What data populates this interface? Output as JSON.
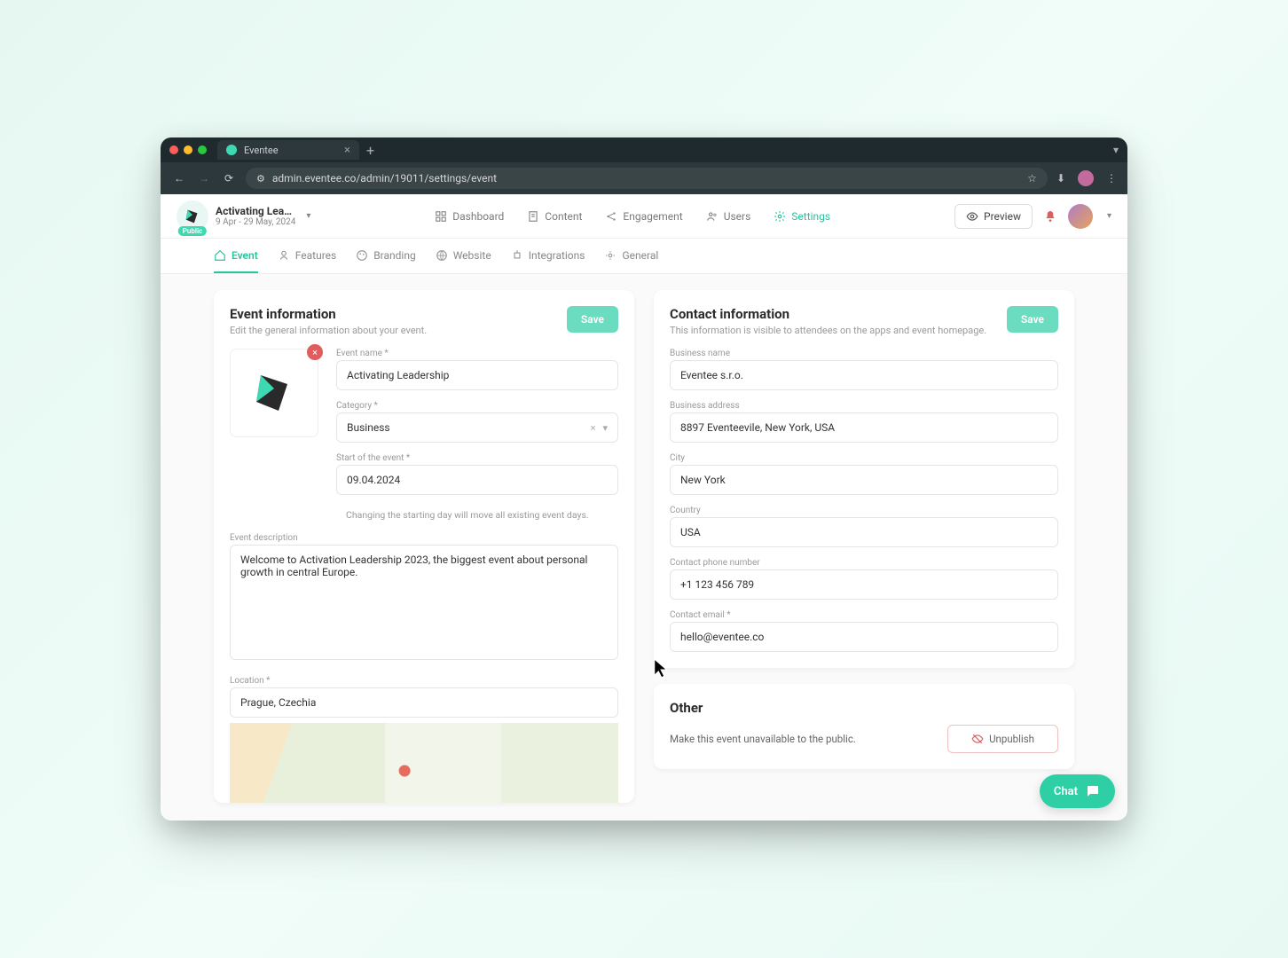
{
  "browser": {
    "tab_title": "Eventee",
    "url": "admin.eventee.co/admin/19011/settings/event"
  },
  "header": {
    "event_name_short": "Activating Lea…",
    "event_dates": "9 Apr - 29 May, 2024",
    "public_badge": "Public",
    "nav": {
      "dashboard": "Dashboard",
      "content": "Content",
      "engagement": "Engagement",
      "users": "Users",
      "settings": "Settings"
    },
    "preview": "Preview"
  },
  "subnav": {
    "event": "Event",
    "features": "Features",
    "branding": "Branding",
    "website": "Website",
    "integrations": "Integrations",
    "general": "General"
  },
  "event_info": {
    "title": "Event information",
    "subtitle": "Edit the general information about your event.",
    "save": "Save",
    "labels": {
      "name": "Event name *",
      "category": "Category *",
      "start": "Start of the event *",
      "description": "Event description",
      "location": "Location *"
    },
    "values": {
      "name": "Activating Leadership",
      "category": "Business",
      "start": "09.04.2024",
      "start_hint": "Changing the starting day will move all existing event days.",
      "description": "Welcome to Activation Leadership 2023, the biggest event about personal growth in central Europe.",
      "location": "Prague, Czechia"
    }
  },
  "contact": {
    "title": "Contact information",
    "subtitle": "This information is visible to attendees on the apps and event homepage.",
    "save": "Save",
    "labels": {
      "business": "Business name",
      "address": "Business address",
      "city": "City",
      "country": "Country",
      "phone": "Contact phone number",
      "email": "Contact email *"
    },
    "values": {
      "business": "Eventee s.r.o.",
      "address": "8897 Eventeevile, New York, USA",
      "city": "New York",
      "country": "USA",
      "phone": "+1 123 456 789",
      "email": "hello@eventee.co"
    }
  },
  "other": {
    "title": "Other",
    "desc": "Make this event unavailable to the public.",
    "unpublish": "Unpublish"
  },
  "chat": "Chat"
}
